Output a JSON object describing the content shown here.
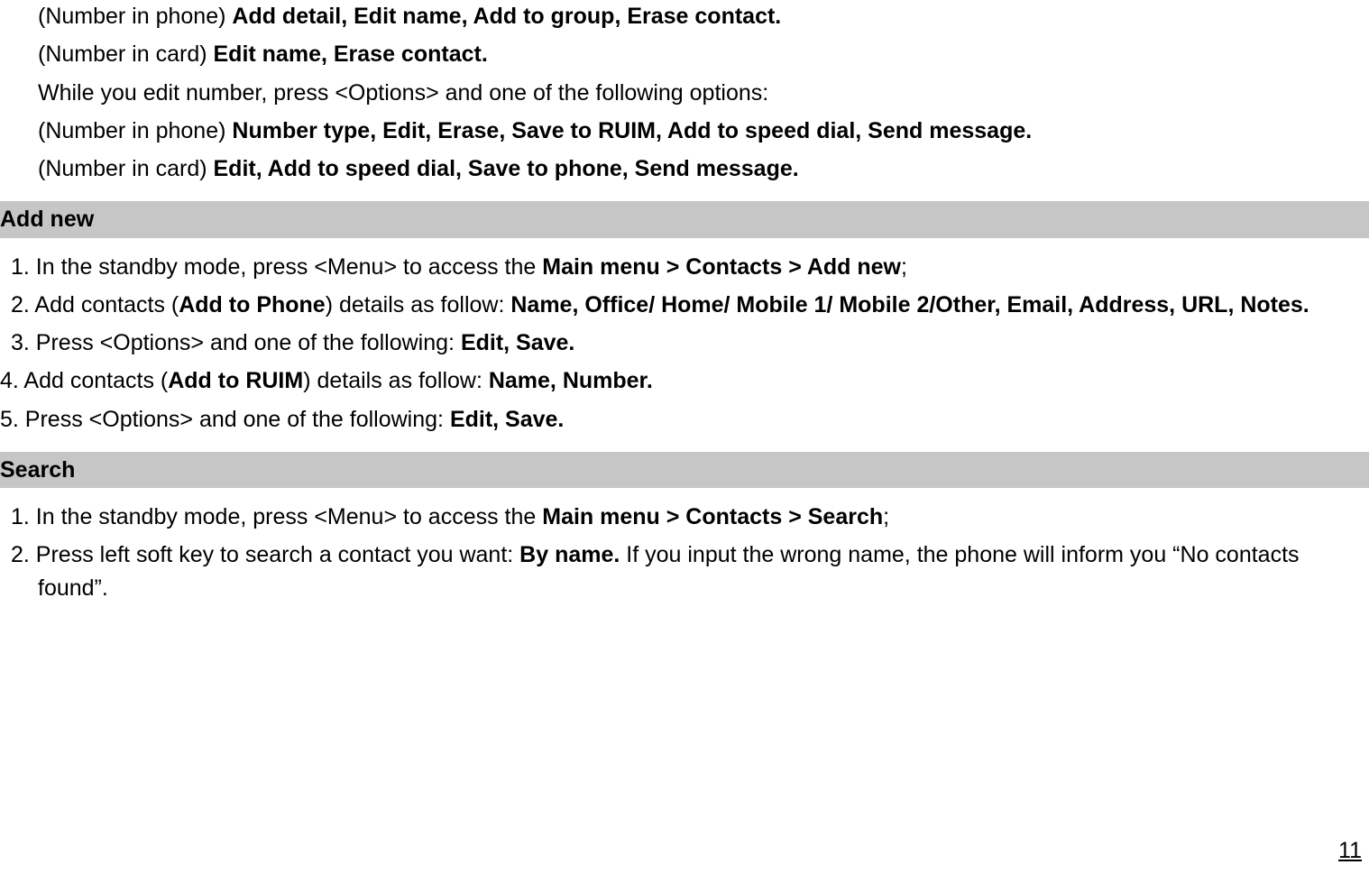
{
  "top": {
    "line1_prefix": "(Number in phone) ",
    "line1_bold": "Add detail, Edit name, Add to group, Erase contact.",
    "line2_prefix": "(Number in card) ",
    "line2_bold": "Edit name, Erase contact.",
    "line3": " While you edit number, press <Options> and one of the following options:",
    "line4_prefix": "(Number in phone) ",
    "line4_bold": "Number type, Edit, Erase, Save to RUIM, Add to speed dial, Send message.",
    "line5_prefix": "(Number in card) ",
    "line5_bold": "Edit, Add to speed dial, Save to phone, Send message."
  },
  "section_addnew": {
    "heading": "Add new",
    "item1_num": "1.",
    "item1_a": " In the standby mode, press <Menu> to access the ",
    "item1_b": "Main menu > Contacts > Add new",
    "item1_c": ";",
    "item2_num": "2.",
    "item2_a": " Add contacts (",
    "item2_b": "Add to Phone",
    "item2_c": ") details as follow: ",
    "item2_d": "Name, Office/ Home/ Mobile 1/ Mobile 2/Other, Email, Address, URL, Notes.",
    "item3_num": "3.",
    "item3_a": " Press <Options> and one of the following: ",
    "item3_b": "Edit, Save.",
    "item4_num": "4.",
    "item4_a": " Add contacts (",
    "item4_b": "Add to RUIM",
    "item4_c": ") details as follow: ",
    "item4_d": "Name, Number.",
    "item5_num": "5.",
    "item5_a": " Press <Options> and one of the following: ",
    "item5_b": "Edit, Save."
  },
  "section_search": {
    "heading": "Search",
    "item1_num": "1.",
    "item1_a": " In the standby mode, press <Menu> to access the ",
    "item1_b": "Main menu > Contacts > Search",
    "item1_c": ";",
    "item2_num": "2.",
    "item2_a": " Press left soft key to search a contact you want: ",
    "item2_b": "By name.",
    "item2_c": " If you input the wrong name, the phone will inform you “No contacts found”."
  },
  "page_number": "11"
}
